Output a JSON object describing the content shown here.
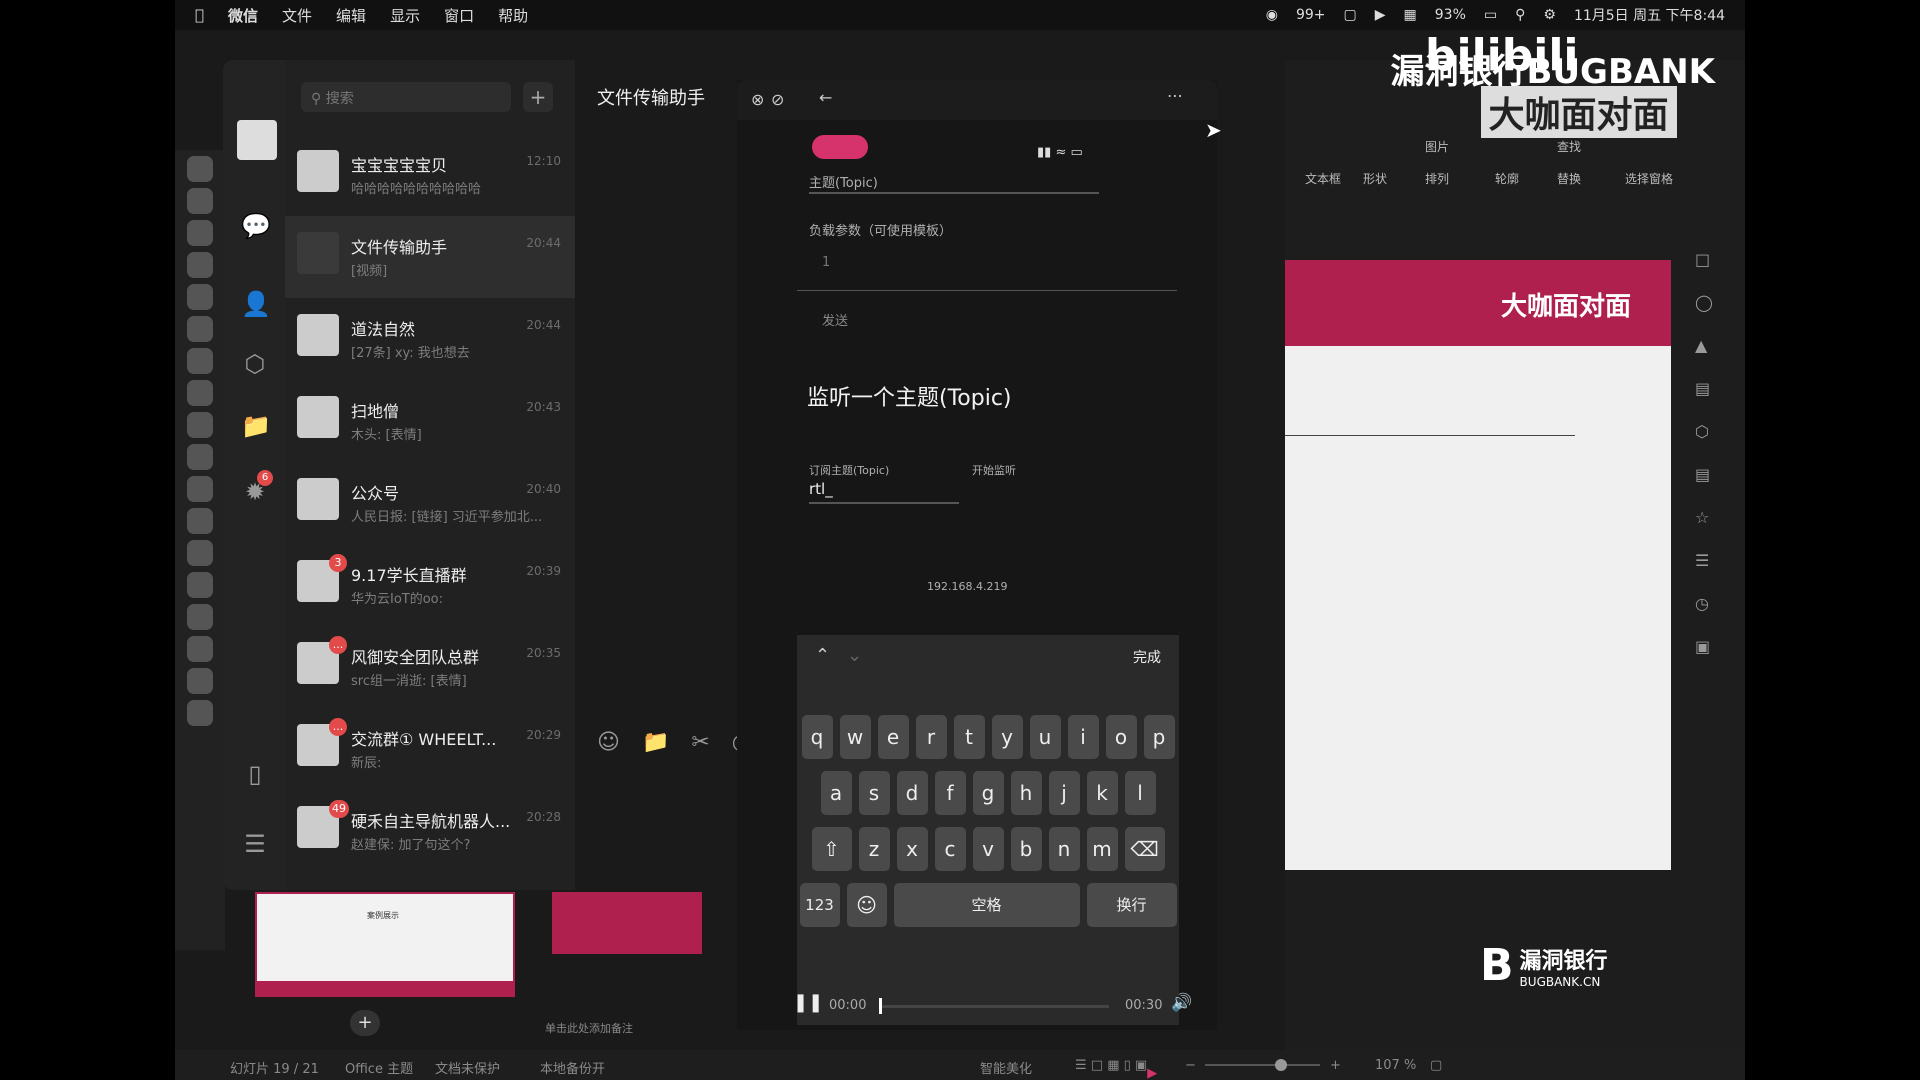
{
  "menubar": {
    "app": "微信",
    "items": [
      "文件",
      "编辑",
      "显示",
      "窗口",
      "帮助"
    ],
    "wechat_badge": "99+",
    "battery": "93%",
    "datetime": "11月5日 周五 下午8:44"
  },
  "watermark": {
    "line1": "漏洞银行BUGBANK",
    "line2": "大咖面对面",
    "brand": "bilibili"
  },
  "wechat": {
    "search_placeholder": "搜索",
    "plus": "+",
    "active_chat_title": "文件传输助手",
    "chats": [
      {
        "name": "宝宝宝宝宝贝",
        "msg": "哈哈哈哈哈哈哈哈哈哈",
        "time": "12:10",
        "badge": ""
      },
      {
        "name": "文件传输助手",
        "msg": "[视频]",
        "time": "20:44",
        "badge": ""
      },
      {
        "name": "道法自然",
        "msg": "[27条] xy: 我也想去",
        "time": "20:44",
        "badge": ""
      },
      {
        "name": "扫地僧",
        "msg": "木头: [表情]",
        "time": "20:43",
        "badge": ""
      },
      {
        "name": "公众号",
        "msg": "人民日报: [链接] 习近平参加北...",
        "time": "20:40",
        "badge": ""
      },
      {
        "name": "9.17学长直播群",
        "msg": "华为云IoT的oo:",
        "time": "20:39",
        "badge": "3"
      },
      {
        "name": "风御安全团队总群",
        "msg": "src组一消逝: [表情]",
        "time": "20:35",
        "badge": "..."
      },
      {
        "name": "交流群① WHEELT...",
        "msg": "新辰:",
        "time": "20:29",
        "badge": "..."
      },
      {
        "name": "硬禾自主导航机器人...",
        "msg": "赵建保: 加了句这个?",
        "time": "20:28",
        "badge": "49"
      }
    ],
    "sidebar_badge": "6"
  },
  "phone": {
    "topic_label": "主题(Topic)",
    "payload_label": "负载参数（可使用模板）",
    "payload_line_no": "1",
    "send_label": "发送",
    "heading": "监听一个主题(Topic)",
    "subscribe_label": "订阅主题(Topic)",
    "subscribe_value": "rtl_",
    "start_listen": "开始监听",
    "ip": "192.168.4.219",
    "done": "完成",
    "row1": [
      "q",
      "w",
      "e",
      "r",
      "t",
      "y",
      "u",
      "i",
      "o",
      "p"
    ],
    "row2": [
      "a",
      "s",
      "d",
      "f",
      "g",
      "h",
      "j",
      "k",
      "l"
    ],
    "row3": [
      "z",
      "x",
      "c",
      "v",
      "b",
      "n",
      "m"
    ],
    "num_key": "123",
    "space_key": "空格",
    "return_key": "换行",
    "time_start": "00:00",
    "time_end": "00:30",
    "video_progress": 0.0
  },
  "ppt": {
    "ribbon": [
      "文本框",
      "形状",
      "图片",
      "排列",
      "轮廓",
      "替换",
      "选择窗格",
      "查找"
    ],
    "slide_title_text": "大咖面对面",
    "thumb_label": "案例展示",
    "notes_placeholder": "单击此处添加备注",
    "brand_cn": "漏洞银行",
    "brand_en": "BUGBANK.CN"
  },
  "statusbar": {
    "slide_info": "幻灯片 19 / 21",
    "theme": "Office 主题",
    "protect": "文档未保护",
    "backup": "本地备份开",
    "beautify": "智能美化",
    "zoom": "107 %"
  },
  "colors": {
    "accent": "#b0204f",
    "badge": "#e34b4b",
    "pill": "#d6336c"
  }
}
